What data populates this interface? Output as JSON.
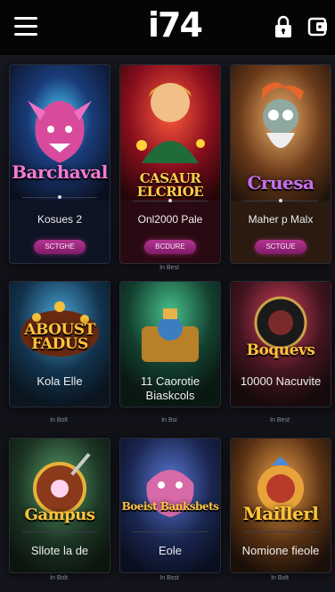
{
  "header": {
    "logo": "i74",
    "menu_icon": "hamburger-menu-icon",
    "lock_icon": "lock-icon",
    "wallet_icon": "wallet-icon"
  },
  "games": [
    {
      "title": "Barchaval",
      "info": "Kosues 2",
      "button": "SCTGHE",
      "foot": "In Best"
    },
    {
      "title": "CASAUR ELCRIOE",
      "info": "Onl2000 Pale",
      "button": "BCDURE",
      "foot": ""
    },
    {
      "title": "Cruesa",
      "info": "Maher p Malx",
      "button": "SCTGUE",
      "foot": ""
    },
    {
      "title": "ABOUST FADUS",
      "info": "Kola Elle",
      "button": "",
      "foot": "In Bolt"
    },
    {
      "title": "",
      "info": "11 Caorotie Biaskcols",
      "button": "",
      "foot": "In Bsi"
    },
    {
      "title": "Boquevs",
      "info": "10000 Nacuvite",
      "button": "",
      "foot": "In Best"
    },
    {
      "title": "Gampus",
      "info": "Sllote la de",
      "button": "",
      "foot": "In Bolt"
    },
    {
      "title": "Boeist Banksbets",
      "info": "Eole",
      "button": "",
      "foot": "In Bsst"
    },
    {
      "title": "Maillerl",
      "info": "Nomione fieole",
      "button": "",
      "foot": "In Bolt"
    }
  ],
  "colors": {
    "accent": "#b43592",
    "background": "#0c0d12"
  }
}
